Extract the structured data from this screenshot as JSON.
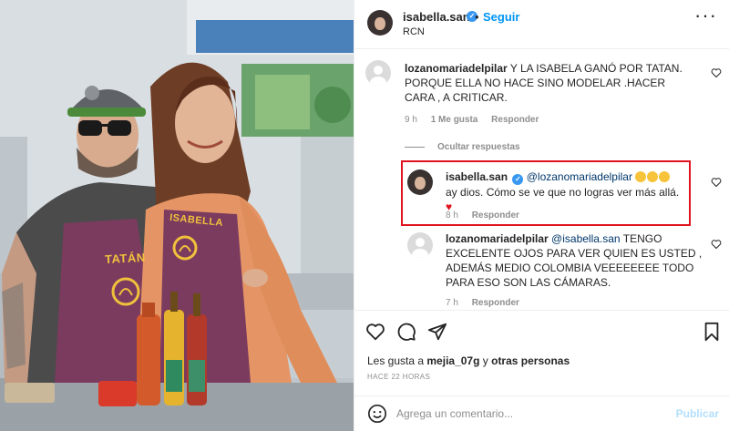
{
  "post": {
    "apron_left": "TATÁN",
    "apron_right": "ISABELLA"
  },
  "header": {
    "username": "isabella.san",
    "verified_icon": "verified-badge-icon",
    "dot": "•",
    "follow_label": "Seguir",
    "location": "RCN",
    "more_icon": "more-options-icon"
  },
  "comments": [
    {
      "username": "lozanomariadelpilar",
      "text": "Y LA ISABELA GANÓ POR TATAN. PORQUE ELLA NO HACE SINO MODELAR .HACER CARA , A CRITICAR.",
      "time": "9 h",
      "likes": "1 Me gusta",
      "reply": "Responder"
    }
  ],
  "hide_replies_label": "Ocultar respuestas",
  "replies": [
    {
      "username": "isabella.san",
      "mention": "@lozanomariadelpilar",
      "text_line1_after": "ay",
      "text_line2": "dios. Cómo se ve que no logras ver más allá.",
      "time": "8 h",
      "reply": "Responder",
      "highlighted": true,
      "highlight_color": "#e0141e"
    },
    {
      "username": "lozanomariadelpilar",
      "mention": "@isabella.san",
      "text": "TENGO EXCELENTE OJOS PARA VER QUIEN ES USTED , ADEMÁS MEDIO COLOMBIA VEEEEEEEE TODO PARA ESO SON LAS CÁMARAS.",
      "time": "7 h",
      "reply": "Responder"
    }
  ],
  "actions": {
    "likes_prefix": "Les gusta a ",
    "likes_user": "mejia_07g",
    "likes_middle": " y ",
    "likes_others": "otras personas",
    "time_ago": "HACE 22 HORAS"
  },
  "comment_box": {
    "placeholder": "Agrega un comentario...",
    "publish_label": "Publicar"
  },
  "colors": {
    "link_blue": "#0095f6",
    "mention_blue": "#00376b",
    "highlight_red": "#e0141e",
    "apron_purple": "#7b3b5f"
  }
}
